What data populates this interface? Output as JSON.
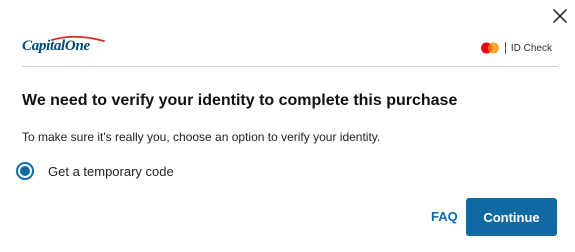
{
  "dialog": {
    "close_icon": "close-icon",
    "brand": {
      "logo_text": "CapitalOne"
    },
    "id_check": {
      "network_icon": "mastercard-icon",
      "label": "ID Check"
    },
    "title": "We need to verify your identity to complete this purchase",
    "subtitle": "To make sure it's really you, choose an option to verify your identity.",
    "options": [
      {
        "label": "Get a temporary code",
        "selected": true
      }
    ],
    "footer": {
      "faq_label": "FAQ",
      "continue_label": "Continue"
    }
  },
  "colors": {
    "brand_blue": "#004977",
    "brand_red": "#d22e1e",
    "accent": "#0f6aa3",
    "mastercard_red": "#eb001b",
    "mastercard_orange": "#f79e1b"
  }
}
